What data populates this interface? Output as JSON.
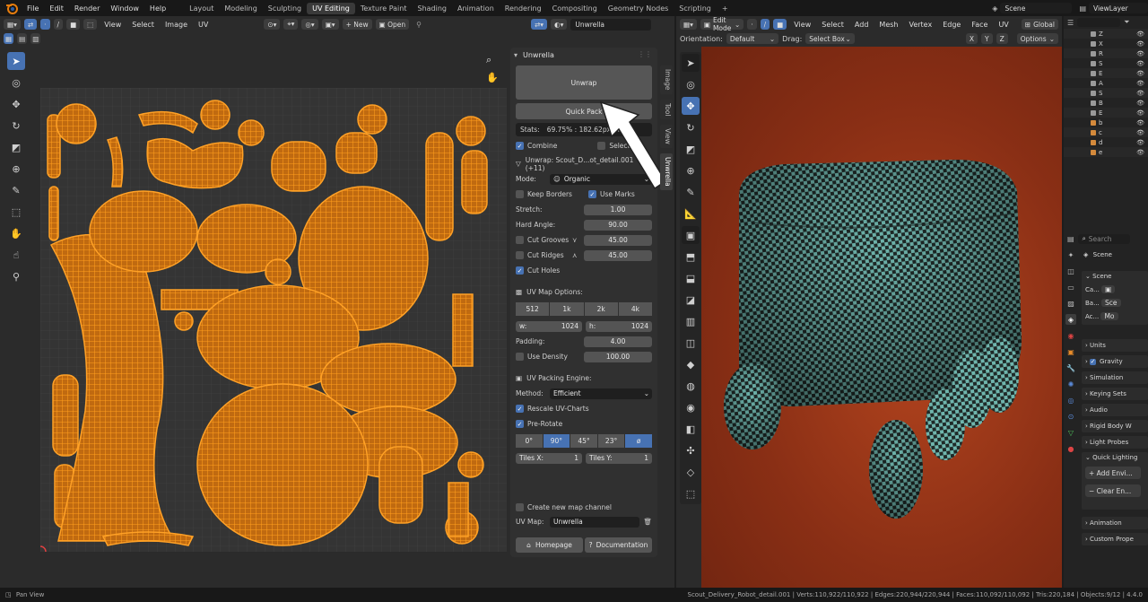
{
  "menubar": {
    "items": [
      "File",
      "Edit",
      "Render",
      "Window",
      "Help"
    ],
    "workspaces": [
      "Layout",
      "Modeling",
      "Sculpting",
      "UV Editing",
      "Texture Paint",
      "Shading",
      "Animation",
      "Rendering",
      "Compositing",
      "Geometry Nodes",
      "Scripting"
    ],
    "active_workspace": "UV Editing",
    "scene": "Scene",
    "view_layer": "ViewLayer"
  },
  "uv_editor": {
    "menus": [
      "View",
      "Select",
      "Image",
      "UV"
    ],
    "new_label": "New",
    "open_label": "Open",
    "uvmap_field": "Unwrella",
    "tabs": [
      "Image",
      "Tool",
      "View",
      "Unwrella"
    ]
  },
  "unwrella": {
    "title": "Unwrella",
    "unwrap_label": "Unwrap",
    "quick_pack_label": "Quick Pack",
    "stats_label": "Stats:",
    "stats_value": "69.75% : 182.62px/m",
    "combine_label": "Combine",
    "selection_label": "Selection",
    "section_unwrap": "Unwrap: Scout_D...ot_detail.001 (+11)",
    "mode_label": "Mode:",
    "mode_value": "Organic",
    "keep_borders_label": "Keep Borders",
    "use_marks_label": "Use Marks",
    "stretch_label": "Stretch:",
    "stretch_value": "1.00",
    "hard_angle_label": "Hard Angle:",
    "hard_angle_value": "90.00",
    "cut_grooves_label": "Cut Grooves",
    "cut_grooves_value": "45.00",
    "cut_ridges_label": "Cut Ridges",
    "cut_ridges_value": "45.00",
    "cut_holes_label": "Cut Holes",
    "uv_map_options_label": "UV Map Options:",
    "resolutions": [
      "512",
      "1k",
      "2k",
      "4k"
    ],
    "w_label": "w:",
    "w_value": "1024",
    "h_label": "h:",
    "h_value": "1024",
    "padding_label": "Padding:",
    "padding_value": "4.00",
    "use_density_label": "Use Density",
    "density_value": "100.00",
    "packing_engine_label": "UV Packing Engine:",
    "method_label": "Method:",
    "method_value": "Efficient",
    "rescale_label": "Rescale UV-Charts",
    "prerotate_label": "Pre-Rotate",
    "angles": [
      "0°",
      "90°",
      "45°",
      "23°",
      "ø"
    ],
    "tiles_x_label": "Tiles X:",
    "tiles_x_value": "1",
    "tiles_y_label": "Tiles Y:",
    "tiles_y_value": "1",
    "create_new_map_label": "Create new map channel",
    "uv_map_label": "UV Map:",
    "uv_map_value": "Unwrella",
    "homepage_label": "Homepage",
    "documentation_label": "Documentation"
  },
  "viewport": {
    "mode": "Edit Mode",
    "menus": [
      "View",
      "Select",
      "Add",
      "Mesh",
      "Vertex",
      "Edge",
      "Face",
      "UV"
    ],
    "transform": "Global",
    "orientation_label": "Orientation:",
    "orientation_value": "Default",
    "drag_label": "Drag:",
    "drag_value": "Select Box",
    "axes": [
      "X",
      "Y",
      "Z"
    ],
    "options_label": "Options"
  },
  "outliner": {
    "search_placeholder": "",
    "rows": [
      "Z",
      "X",
      "R",
      "S",
      "E",
      "A",
      "S",
      "B",
      "E",
      "b",
      "c",
      "d",
      "e"
    ]
  },
  "properties": {
    "search_placeholder": "Search",
    "scene_label": "Scene",
    "section_scene": "Scene",
    "camera_label": "Ca...",
    "background_label": "Ba...",
    "background_value": "Sce",
    "active_clip_label": "Ac...",
    "active_clip_value": "Mo",
    "sections": [
      "Units",
      "Gravity",
      "Simulation",
      "Keying Sets",
      "Audio",
      "Rigid Body W",
      "Light Probes",
      "Quick Lighting"
    ],
    "add_env_label": "Add Envi...",
    "clear_env_label": "Clear En...",
    "animation_label": "Animation",
    "custom_props_label": "Custom Prope"
  },
  "statusbar": {
    "left": "Pan View",
    "stats": "Scout_Delivery_Robot_detail.001 | Verts:110,922/110,922 | Edges:220,944/220,944 | Faces:110,092/110,092 | Tris:220,184 | Objects:9/12 | 4.4.0"
  },
  "colors": {
    "accent": "#4772b3",
    "uv_orange": "#f08a12",
    "viewport_bg": "#a23a1a",
    "checker_a": "#6fb5ad",
    "checker_b": "#1f2a28"
  }
}
